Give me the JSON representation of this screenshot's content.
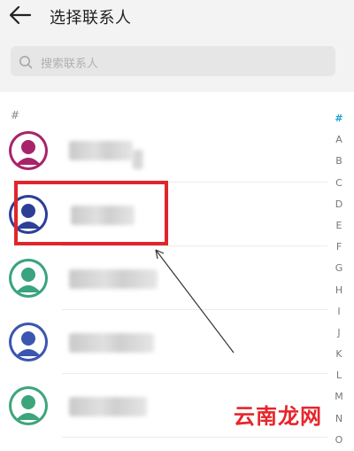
{
  "header": {
    "title": "选择联系人",
    "back_icon": "arrow-left-icon"
  },
  "search": {
    "placeholder": "搜索联系人",
    "icon": "search-icon"
  },
  "section": {
    "label": "#"
  },
  "contacts": [
    {
      "avatar_color": "#a8246a"
    },
    {
      "avatar_color": "#2b3f97"
    },
    {
      "avatar_color": "#3aa37f"
    },
    {
      "avatar_color": "#3b56b0"
    },
    {
      "avatar_color": "#3ea57b"
    }
  ],
  "index": [
    "#",
    "A",
    "B",
    "C",
    "D",
    "E",
    "F",
    "G",
    "H",
    "I",
    "J",
    "K",
    "L",
    "M",
    "N",
    "O"
  ],
  "index_active": "#",
  "colors": {
    "accent": "#1aa4d1",
    "highlight": "#e0252b"
  },
  "watermark": "云南龙网"
}
